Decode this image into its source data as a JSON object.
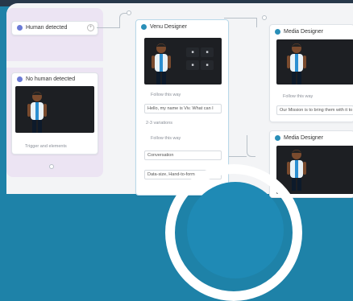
{
  "lane_top": {
    "title": "Human detected"
  },
  "lane_bottom": {
    "title": "No human detected",
    "footer": "Trigger and elements"
  },
  "main_card": {
    "title": "Venu Designer",
    "action_label": "Follow this way",
    "action_value": "Hello, my name is Viv. What can I",
    "option_count": "2-3 variations",
    "section_label": "Follow this way",
    "select_value": "Conversation",
    "bottom_value": "Data-size, Hand-to-form"
  },
  "media_card_1": {
    "title": "Media Designer",
    "label": "Follow this way",
    "value": "Our Mission is to bring them with it to"
  },
  "media_card_2": {
    "title": "Media Designer"
  },
  "plus_symbol": "+",
  "colors": {
    "brand": "#1e82a8",
    "dark_bar": "#27384a",
    "lane": "#ece4f3"
  }
}
